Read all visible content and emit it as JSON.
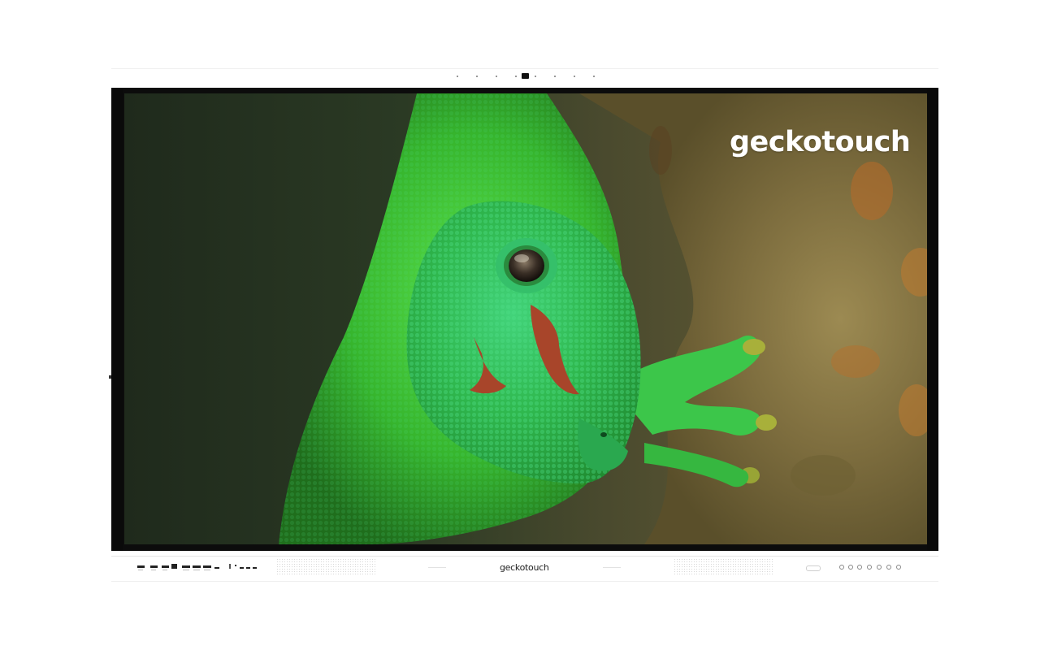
{
  "brand": {
    "screen_logo": "geckotouch",
    "bezel_logo": "geckotouch"
  },
  "colors": {
    "bezel": "#ffffff",
    "screen_frame": "#0c0c0c",
    "gecko_green": "#3fd23a",
    "gecko_red": "#a8452a",
    "bark": "#8a7a48"
  },
  "icons": {
    "top_camera": "camera-icon",
    "front_ports": [
      "usb-port-icon",
      "usb-port-icon",
      "usb-port-icon",
      "hdmi-port-icon",
      "usb-c-port-icon",
      "usb-c-port-icon",
      "usb-c-port-icon",
      "audio-port-icon"
    ],
    "control_buttons": [
      "power-icon",
      "volume-down-icon",
      "volume-up-icon",
      "input-icon",
      "settings-icon",
      "back-icon",
      "home-icon"
    ]
  }
}
